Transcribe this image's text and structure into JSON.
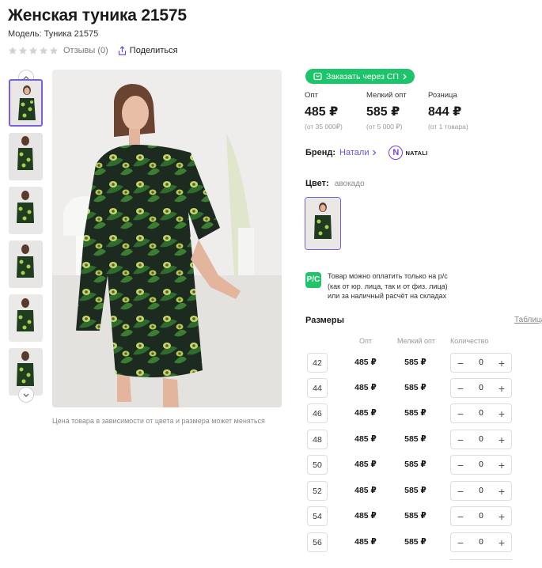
{
  "product": {
    "title": "Женская туника 21575",
    "model": "Модель: Туника 21575",
    "reviews": "Отзывы (0)",
    "share": "Поделиться"
  },
  "gallery": {
    "caption": "Цена товара в зависимости от цвета и размера может меняться",
    "thumb_count": 6
  },
  "order": {
    "sp_label": "Заказать через СП"
  },
  "prices": [
    {
      "label": "Опт",
      "value": "485 ₽",
      "sub": "(от 35 000₽)"
    },
    {
      "label": "Мелкий опт",
      "value": "585 ₽",
      "sub": "(от 5 000 ₽)"
    },
    {
      "label": "Розница",
      "value": "844 ₽",
      "sub": "(от 1 товара)"
    }
  ],
  "brand": {
    "label": "Бренд:",
    "value": "Натали",
    "logo_text": "NATALI"
  },
  "color": {
    "label": "Цвет:",
    "value": "авокадо"
  },
  "payment": {
    "icon_text": "P/C",
    "line1": "Товар можно оплатить только на р/с",
    "line2": "(как от юр. лица, так и от физ. лица)",
    "line3": "или за наличный расчёт на складах"
  },
  "sizes": {
    "title": "Размеры",
    "table_link": "Таблица",
    "headers": {
      "opt": "Опт",
      "melk": "Мелкий опт",
      "qty": "Количество"
    },
    "rows": [
      {
        "size": "42",
        "opt": "485 ₽",
        "melk": "585 ₽",
        "qty": "0"
      },
      {
        "size": "44",
        "opt": "485 ₽",
        "melk": "585 ₽",
        "qty": "0"
      },
      {
        "size": "46",
        "opt": "485 ₽",
        "melk": "585 ₽",
        "qty": "0"
      },
      {
        "size": "48",
        "opt": "485 ₽",
        "melk": "585 ₽",
        "qty": "0"
      },
      {
        "size": "50",
        "opt": "485 ₽",
        "melk": "585 ₽",
        "qty": "0"
      },
      {
        "size": "52",
        "opt": "485 ₽",
        "melk": "585 ₽",
        "qty": "0"
      },
      {
        "size": "54",
        "opt": "485 ₽",
        "melk": "585 ₽",
        "qty": "0"
      },
      {
        "size": "56",
        "opt": "485 ₽",
        "melk": "585 ₽",
        "qty": "0"
      }
    ]
  },
  "colors": {
    "accent": "#7b61d9",
    "green": "#1ec46c",
    "brand_link": "#6a4fd3"
  }
}
